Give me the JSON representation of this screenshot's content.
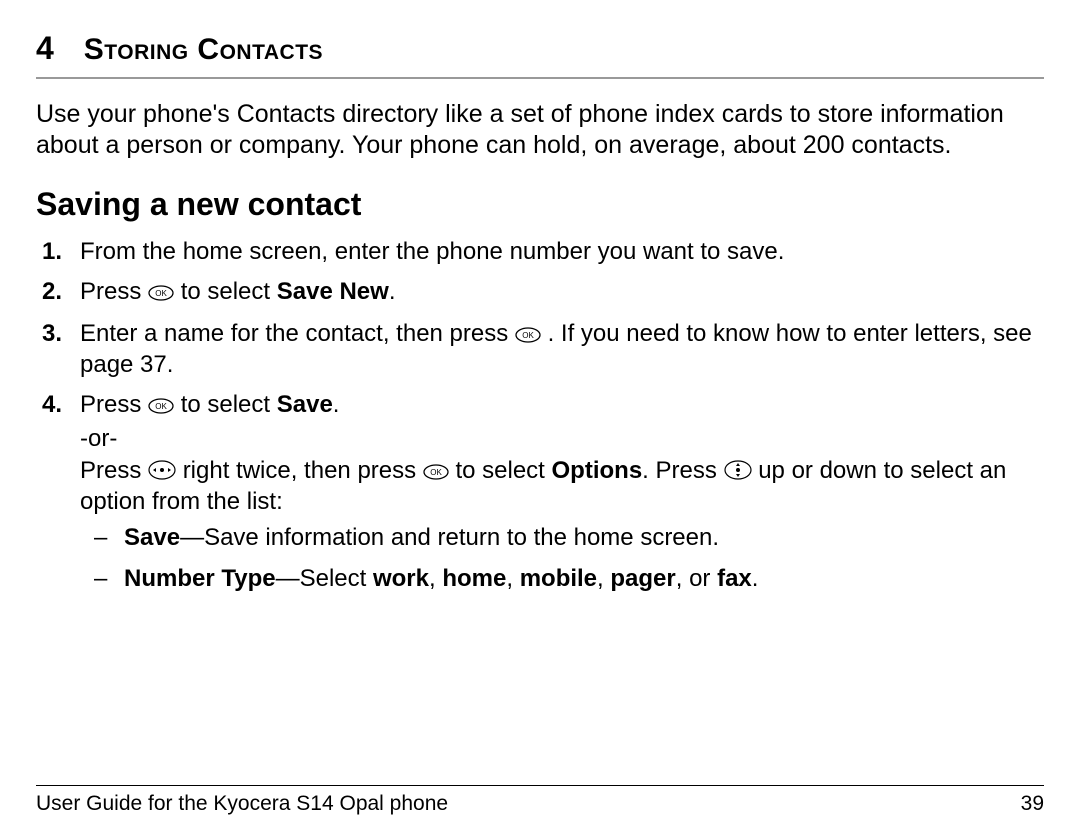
{
  "chapter": {
    "number": "4",
    "title": "Storing Contacts"
  },
  "intro": "Use your phone's Contacts directory like a set of phone index cards to store information about a person or company. Your phone can hold, on average, about 200 contacts.",
  "section_heading": "Saving a new contact",
  "steps": {
    "s1": "From the home screen, enter the phone number you want to save.",
    "s2_a": "Press ",
    "s2_b": " to select ",
    "s2_bold": "Save New",
    "s2_c": ".",
    "s3_a": "Enter a name for the contact, then press ",
    "s3_b": " . If you need to know how to enter letters, see page 37.",
    "s4_a": "Press ",
    "s4_b": " to select ",
    "s4_bold": "Save",
    "s4_c": ".",
    "or": "-or-",
    "s4_alt_a": "Press ",
    "s4_alt_b": " right twice, then press ",
    "s4_alt_c": " to select ",
    "s4_alt_bold": "Options",
    "s4_alt_d": ". Press ",
    "s4_alt_e": " up or down to select an option from the list:"
  },
  "options": {
    "save_label": "Save",
    "save_desc": "—Save information and return to the home screen.",
    "numtype_label": "Number Type",
    "numtype_mid": "—Select ",
    "w_work": "work",
    "sep1": ", ",
    "w_home": "home",
    "sep2": ", ",
    "w_mobile": "mobile",
    "sep3": ", ",
    "w_pager": "pager",
    "sep4": ", or ",
    "w_fax": "fax",
    "numtype_end": "."
  },
  "footer": {
    "left": "User Guide for the Kyocera S14 Opal phone",
    "right": "39"
  },
  "icons": {
    "ok": "ok-button-icon",
    "nav": "nav-pad-icon"
  }
}
